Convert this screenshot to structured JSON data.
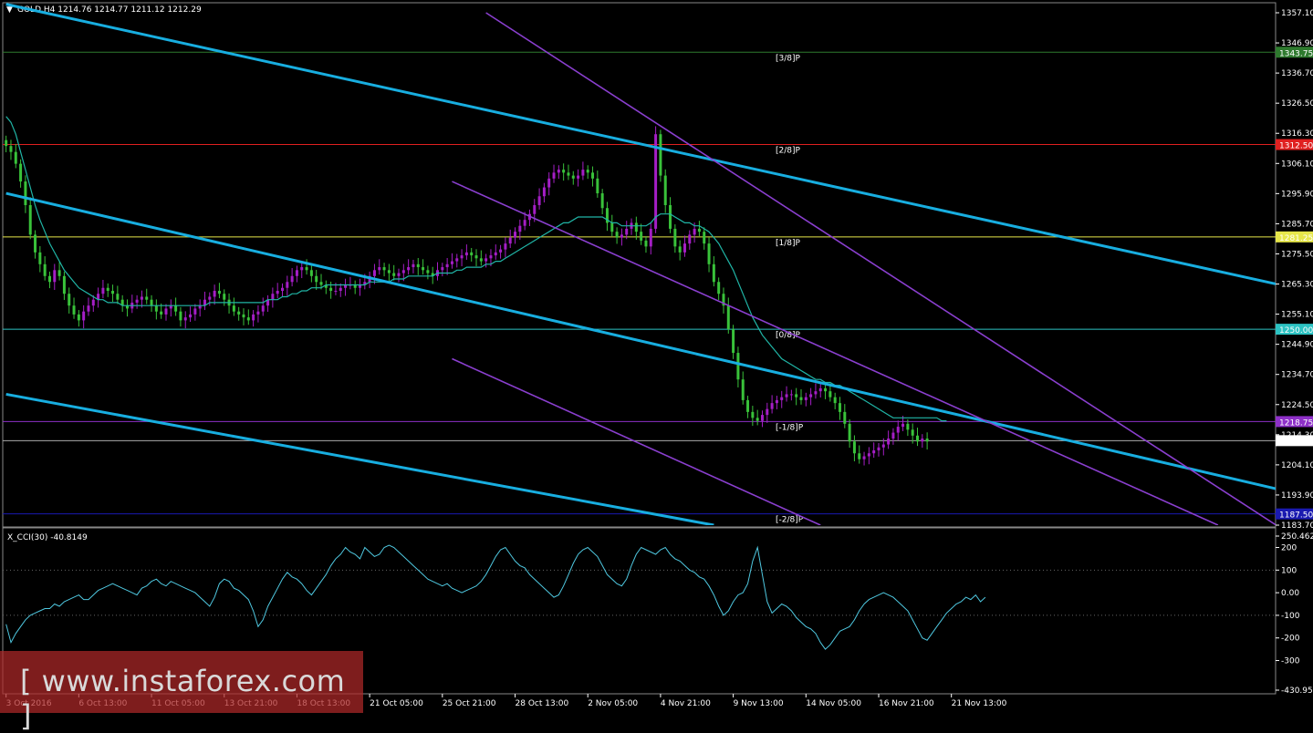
{
  "window": {
    "menu_icon": "dropdown-triangle-icon",
    "header_label": "GOLD,H4  1214.76 1214.77 1211.12 1212.29"
  },
  "colors": {
    "background": "#000000",
    "bull_candle": "#a51ec6",
    "bear_candle": "#39c23a",
    "ma_line": "#20b5a6",
    "channel_blue": "#18aee0",
    "channel_purple": "#8a3fcf",
    "cci_line": "#4fc8e0",
    "axis_text": "#ffffff"
  },
  "chart_data": [
    {
      "type": "line",
      "name": "main",
      "title": "GOLD,H4",
      "ohlc": {
        "open": 1214.76,
        "high": 1214.77,
        "low": 1211.12,
        "close": 1212.29
      },
      "ylim": [
        1183.7,
        1357.1
      ],
      "y_ticks": [
        "1357.10",
        "1346.90",
        "1336.70",
        "1326.50",
        "1316.30",
        "1306.10",
        "1295.90",
        "1285.70",
        "1275.50",
        "1265.30",
        "1255.10",
        "1244.90",
        "1234.70",
        "1224.50",
        "1214.30",
        "1204.10",
        "1193.90",
        "1183.70"
      ],
      "x_ticks": [
        "3 Oct 2016",
        "6 Oct 13:00",
        "11 Oct 05:00",
        "13 Oct 21:00",
        "18 Oct 13:00",
        "21 Oct 05:00",
        "25 Oct 21:00",
        "28 Oct 13:00",
        "2 Nov 05:00",
        "4 Nov 21:00",
        "9 Nov 13:00",
        "14 Nov 05:00",
        "16 Nov 21:00",
        "21 Nov 13:00"
      ],
      "x_tick_index": [
        0,
        15,
        30,
        45,
        60,
        75,
        90,
        105,
        120,
        135,
        150,
        165,
        180,
        195
      ],
      "close_series": [
        1312,
        1310,
        1306,
        1300,
        1292,
        1282,
        1276,
        1272,
        1268,
        1266,
        1270,
        1268,
        1262,
        1258,
        1255,
        1253,
        1256,
        1258,
        1260,
        1262,
        1264,
        1263,
        1262,
        1260,
        1258,
        1257,
        1259,
        1260,
        1261,
        1260,
        1258,
        1256,
        1255,
        1257,
        1258,
        1256,
        1253,
        1254,
        1255,
        1257,
        1258,
        1260,
        1261,
        1263,
        1262,
        1260,
        1258,
        1256,
        1255,
        1254,
        1253,
        1255,
        1256,
        1258,
        1260,
        1262,
        1263,
        1264,
        1266,
        1268,
        1270,
        1271,
        1270,
        1268,
        1266,
        1265,
        1264,
        1263,
        1263,
        1264,
        1265,
        1265,
        1264,
        1265,
        1266,
        1268,
        1270,
        1271,
        1270,
        1269,
        1268,
        1269,
        1270,
        1271,
        1272,
        1271,
        1270,
        1269,
        1268,
        1270,
        1271,
        1272,
        1273,
        1274,
        1275,
        1276,
        1275,
        1274,
        1273,
        1274,
        1275,
        1276,
        1277,
        1279,
        1281,
        1283,
        1285,
        1287,
        1289,
        1292,
        1295,
        1298,
        1301,
        1303,
        1304,
        1303,
        1302,
        1301,
        1302,
        1304,
        1303,
        1301,
        1296,
        1291,
        1286,
        1283,
        1281,
        1282,
        1284,
        1286,
        1283,
        1280,
        1278,
        1284,
        1316,
        1302,
        1292,
        1284,
        1278,
        1276,
        1279,
        1282,
        1284,
        1283,
        1279,
        1272,
        1266,
        1262,
        1258,
        1250,
        1242,
        1233,
        1226,
        1222,
        1220,
        1219,
        1221,
        1223,
        1225,
        1226,
        1227,
        1228,
        1228,
        1227,
        1226,
        1227,
        1228,
        1229,
        1230,
        1229,
        1227,
        1225,
        1222,
        1218,
        1212,
        1208,
        1206,
        1207,
        1208,
        1209,
        1210,
        1211,
        1213,
        1215,
        1217,
        1218,
        1216,
        1214,
        1212,
        1213,
        1212
      ],
      "ma_series": [
        1322,
        1320,
        1316,
        1310,
        1304,
        1298,
        1292,
        1287,
        1283,
        1279,
        1276,
        1273,
        1270,
        1268,
        1266,
        1264,
        1263,
        1262,
        1261,
        1260,
        1260,
        1259,
        1259,
        1259,
        1258,
        1258,
        1258,
        1258,
        1258,
        1258,
        1258,
        1258,
        1258,
        1258,
        1258,
        1258,
        1258,
        1258,
        1258,
        1258,
        1258,
        1258,
        1259,
        1259,
        1259,
        1259,
        1259,
        1259,
        1259,
        1259,
        1259,
        1259,
        1259,
        1259,
        1260,
        1260,
        1260,
        1261,
        1261,
        1262,
        1262,
        1263,
        1263,
        1264,
        1264,
        1264,
        1265,
        1265,
        1265,
        1265,
        1265,
        1265,
        1265,
        1265,
        1265,
        1266,
        1266,
        1266,
        1266,
        1266,
        1267,
        1267,
        1267,
        1268,
        1268,
        1268,
        1268,
        1268,
        1268,
        1269,
        1269,
        1269,
        1269,
        1270,
        1270,
        1271,
        1271,
        1271,
        1271,
        1272,
        1272,
        1273,
        1273,
        1274,
        1275,
        1276,
        1277,
        1278,
        1279,
        1280,
        1281,
        1282,
        1283,
        1284,
        1285,
        1286,
        1286,
        1287,
        1288,
        1288,
        1288,
        1288,
        1288,
        1288,
        1287,
        1286,
        1286,
        1285,
        1285,
        1285,
        1285,
        1285,
        1285,
        1286,
        1288,
        1289,
        1289,
        1289,
        1288,
        1287,
        1286,
        1286,
        1285,
        1285,
        1284,
        1283,
        1281,
        1279,
        1276,
        1273,
        1270,
        1266,
        1262,
        1258,
        1254,
        1251,
        1248,
        1246,
        1244,
        1242,
        1240,
        1239,
        1238,
        1237,
        1236,
        1235,
        1234,
        1233,
        1233,
        1232,
        1232,
        1231,
        1231,
        1230,
        1229,
        1228,
        1227,
        1226,
        1225,
        1224,
        1223,
        1222,
        1221,
        1220,
        1220,
        1220,
        1220,
        1220,
        1220,
        1220,
        1220,
        1220,
        1220,
        1219,
        1219
      ],
      "murrey_levels": [
        {
          "label": "[3/8]P",
          "price": "1343.75",
          "color": "#2e7a2e"
        },
        {
          "label": "[2/8]P",
          "price": "1312.50",
          "color": "#e02020"
        },
        {
          "label": "[1/8]P",
          "price": "1281.25",
          "color": "#e6e64a"
        },
        {
          "label": "[0/8]P",
          "price": "1250.00",
          "color": "#2cc2c2"
        },
        {
          "label": "[-1/8]P",
          "price": "1218.75",
          "color": "#8e30c8"
        },
        {
          "label": "[-2/8]P",
          "price": "1187.50",
          "color": "#1a1ab0"
        }
      ],
      "current_price": "1212.29",
      "channel_lines": [
        {
          "color": "blue",
          "from": [
            0,
            1360
          ],
          "to": [
            262,
            1265.3
          ]
        },
        {
          "color": "blue",
          "from": [
            0,
            1296
          ],
          "to": [
            262,
            1196
          ]
        },
        {
          "color": "blue",
          "from": [
            0,
            1228
          ],
          "to": [
            146,
            1183.7
          ]
        },
        {
          "color": "purple",
          "from": [
            99,
            1357.1
          ],
          "to": [
            262,
            1183.7
          ]
        },
        {
          "color": "purple",
          "from": [
            92,
            1300
          ],
          "to": [
            250,
            1183.7
          ]
        },
        {
          "color": "purple",
          "from": [
            92,
            1240
          ],
          "to": [
            168,
            1183.7
          ]
        }
      ]
    },
    {
      "type": "line",
      "name": "indicator",
      "title": "X_CCI(30) -40.8149",
      "ylim": [
        -430.9526,
        250.462
      ],
      "y_ticks": [
        "250.462",
        "200",
        "100",
        "0.00",
        "-100",
        "-200",
        "-300",
        "-430.9526"
      ],
      "values": [
        -140,
        -220,
        -180,
        -150,
        -120,
        -100,
        -90,
        -80,
        -70,
        -70,
        -50,
        -60,
        -40,
        -30,
        -20,
        -10,
        -30,
        -30,
        -10,
        10,
        20,
        30,
        40,
        30,
        20,
        10,
        0,
        -10,
        20,
        30,
        50,
        60,
        40,
        30,
        50,
        40,
        30,
        20,
        10,
        0,
        -20,
        -40,
        -60,
        -20,
        40,
        60,
        50,
        20,
        10,
        -10,
        -30,
        -80,
        -150,
        -120,
        -60,
        -20,
        20,
        60,
        90,
        70,
        60,
        40,
        10,
        -10,
        20,
        50,
        80,
        120,
        150,
        170,
        200,
        180,
        170,
        150,
        200,
        180,
        160,
        170,
        200,
        210,
        200,
        180,
        160,
        140,
        120,
        100,
        80,
        60,
        50,
        40,
        30,
        40,
        20,
        10,
        0,
        10,
        20,
        30,
        50,
        80,
        120,
        160,
        190,
        200,
        170,
        140,
        120,
        110,
        80,
        60,
        40,
        20,
        0,
        -20,
        -10,
        30,
        80,
        130,
        170,
        190,
        200,
        180,
        160,
        120,
        80,
        60,
        40,
        30,
        60,
        120,
        170,
        200,
        190,
        180,
        170,
        190,
        200,
        170,
        150,
        140,
        120,
        100,
        90,
        70,
        60,
        30,
        -10,
        -60,
        -100,
        -80,
        -40,
        -10,
        0,
        40,
        140,
        200,
        80,
        -40,
        -90,
        -70,
        -50,
        -60,
        -80,
        -110,
        -130,
        -150,
        -160,
        -180,
        -220,
        -250,
        -230,
        -200,
        -170,
        -160,
        -150,
        -120,
        -80,
        -50,
        -30,
        -20,
        -10,
        0,
        -10,
        -20,
        -40,
        -60,
        -80,
        -120,
        -160,
        -200,
        -210,
        -180,
        -150,
        -120,
        -90,
        -70,
        -50,
        -40,
        -20,
        -30,
        -10,
        -40,
        -20
      ]
    }
  ],
  "watermark": {
    "text": "[ www.instaforex.com ]"
  }
}
